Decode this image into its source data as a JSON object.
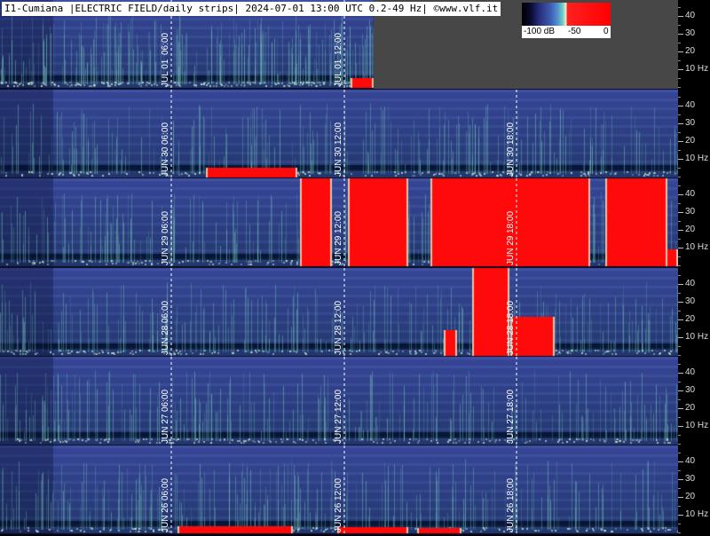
{
  "header": {
    "title": "I1-Cumiana |ELECTRIC FIELD/daily strips| 2024-07-01 13:00 UTC 0.2-49 Hz| ©www.vlf.it"
  },
  "colorbar": {
    "labels": [
      "-100 dB",
      "-50",
      "0"
    ],
    "colors": {
      "floor": "#000000",
      "low": "#3d5ab0",
      "mid": "#6fcfc0",
      "peak": "#ff0000"
    }
  },
  "frequency_scale": {
    "ticks": [
      "40",
      "30",
      "20",
      "10 Hz"
    ]
  },
  "strips": [
    {
      "date_label": "JUL 01",
      "time_labels": [
        "06:00",
        "12:00"
      ],
      "red": []
    },
    {
      "date_label": "JUN 30",
      "time_labels": [
        "06:00",
        "12:00",
        "18:00"
      ],
      "red": []
    },
    {
      "date_label": "JUN 29",
      "time_labels": [
        "06:00",
        "12:00",
        "18:00"
      ],
      "red": []
    },
    {
      "date_label": "JUN 28",
      "time_labels": [
        "06:00",
        "12:00",
        "18:00"
      ],
      "red": []
    },
    {
      "date_label": "JUN 27",
      "time_labels": [
        "06:00",
        "12:00",
        "18:00"
      ],
      "red": []
    },
    {
      "date_label": "JUN 26",
      "time_labels": [
        "06:00",
        "12:00",
        "18:00"
      ],
      "red": []
    }
  ]
}
